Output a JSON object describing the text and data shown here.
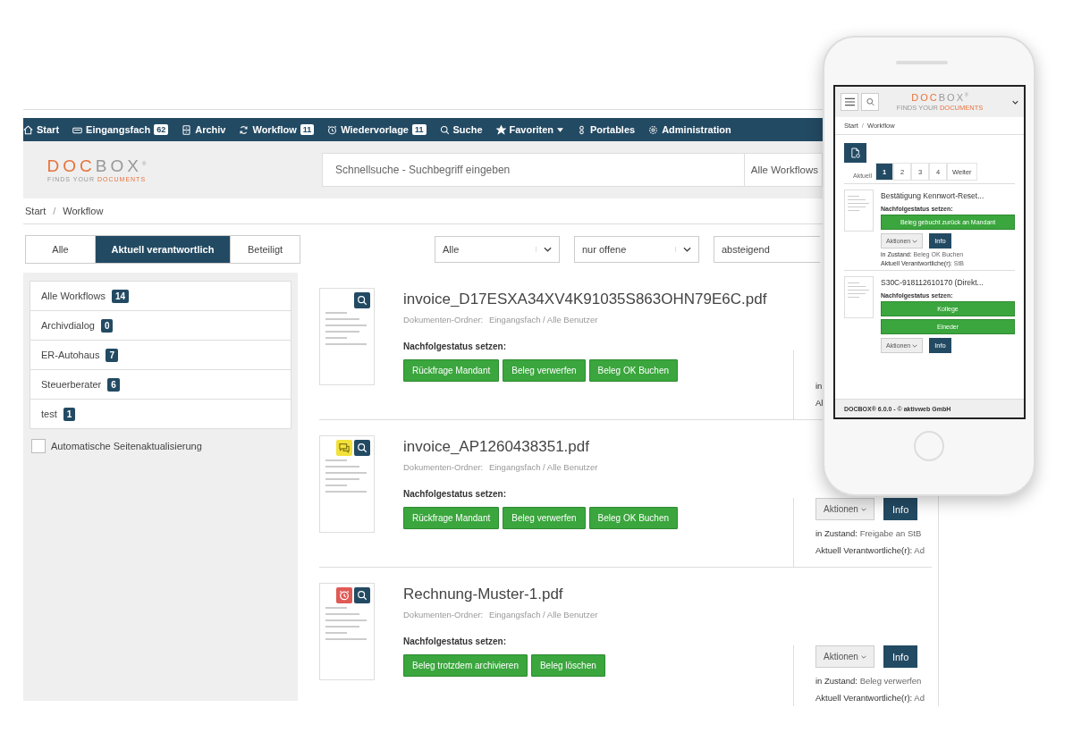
{
  "nav": [
    {
      "label": "Start",
      "dropdown": false
    },
    {
      "label": "Eingangsfach",
      "badge": "62",
      "dropdown": false
    },
    {
      "label": "Archiv",
      "dropdown": false
    },
    {
      "label": "Workflow",
      "badge": "11",
      "dropdown": false
    },
    {
      "label": "Wiedervorlage",
      "badge": "11",
      "dropdown": false
    },
    {
      "label": "Suche",
      "dropdown": false
    },
    {
      "label": "Favoriten",
      "dropdown": true
    },
    {
      "label": "Portables",
      "dropdown": false
    },
    {
      "label": "Administration",
      "dropdown": false
    }
  ],
  "logo": {
    "left": "DOC",
    "right": "BOX",
    "mark": "®",
    "tagline_left": "FINDS YOUR",
    "tagline_right": "DOCUMENTS"
  },
  "search": {
    "placeholder": "Schnellsuche - Suchbegriff eingeben",
    "scope": "Alle Workflows"
  },
  "breadcrumb": {
    "items": [
      "Start",
      "Workflow"
    ],
    "separator": "/"
  },
  "tabs": [
    {
      "label": "Alle",
      "selected": false
    },
    {
      "label": "Aktuell verantwortlich",
      "selected": true
    },
    {
      "label": "Beteiligt",
      "selected": false
    }
  ],
  "filters": [
    {
      "value": "Alle",
      "chevron": true
    },
    {
      "value": "nur offene",
      "chevron": true
    },
    {
      "value": "absteigend",
      "chevron": false
    }
  ],
  "workflows": [
    {
      "label": "Alle Workflows",
      "count": "14"
    },
    {
      "label": "Archivdialog",
      "count": "0"
    },
    {
      "label": "ER-Autohaus",
      "count": "7"
    },
    {
      "label": "Steuerberater",
      "count": "6"
    },
    {
      "label": "test",
      "count": "1"
    }
  ],
  "auto_refresh": {
    "label": "Automatische Seitenaktualisierung",
    "checked": false
  },
  "documents": [
    {
      "title": "invoice_D17ESXA34XV4K91035S863OHN79E6C.pdf",
      "folder_label": "Dokumenten-Ordner:",
      "folder": "Eingangsfach / Alle Benutzer",
      "has_comment": false,
      "has_reminder": false,
      "status_heading": "Nachfolgestatus setzen:",
      "actions": [
        "Rückfrage Mandant",
        "Beleg verwerfen",
        "Beleg OK Buchen"
      ],
      "side": {
        "state_label": "in",
        "owner_label": "Al"
      }
    },
    {
      "title": "invoice_AP1260438351.pdf",
      "folder_label": "Dokumenten-Ordner:",
      "folder": "Eingangsfach / Alle Benutzer",
      "has_comment": true,
      "has_reminder": false,
      "status_heading": "Nachfolgestatus setzen:",
      "actions": [
        "Rückfrage Mandant",
        "Beleg verwerfen",
        "Beleg OK Buchen"
      ],
      "side": {
        "menu": "Aktionen",
        "info": "Info",
        "state_label": "in Zustand:",
        "state": "Freigabe an StB",
        "owner_label": "Aktuell Verantwortliche(r):",
        "owner": "Ad"
      }
    },
    {
      "title": "Rechnung-Muster-1.pdf",
      "folder_label": "Dokumenten-Ordner:",
      "folder": "Eingangsfach / Alle Benutzer",
      "has_comment": false,
      "has_reminder": true,
      "status_heading": "Nachfolgestatus setzen:",
      "actions": [
        "Beleg trotzdem archivieren",
        "Beleg löschen"
      ],
      "side": {
        "menu": "Aktionen",
        "info": "Info",
        "state_label": "in Zustand:",
        "state": "Beleg verwerfen",
        "owner_label": "Aktuell Verantwortliche(r):",
        "owner": "Ad"
      }
    }
  ],
  "phone": {
    "logo": {
      "left": "DOC",
      "right": "BOX",
      "mark": "®",
      "tagline_left": "FINDS YOUR",
      "tagline_right": "DOCUMENTS"
    },
    "breadcrumb": {
      "items": [
        "Start",
        "Workflow"
      ],
      "separator": "/"
    },
    "pagination": {
      "label": "Aktuell",
      "pages": [
        {
          "label": "1",
          "selected": true
        },
        {
          "label": "2",
          "selected": false
        },
        {
          "label": "3",
          "selected": false
        },
        {
          "label": "4",
          "selected": false
        },
        {
          "label": "Weiter",
          "selected": false
        }
      ]
    },
    "documents": [
      {
        "title": "Bestätigung Kennwort-Reset...",
        "status_heading": "Nachfolgestatus setzen:",
        "actions": [
          "Beleg gebucht zurück an Mandant"
        ],
        "menu": "Aktionen",
        "info": "Info",
        "state_label": "in Zustand:",
        "state": "Beleg OK Buchen",
        "owner_label": "Aktuell Verantwortliche(r):",
        "owner": "StB"
      },
      {
        "title": "S30C-918112610170 (Direkt...",
        "status_heading": "Nachfolgestatus setzen:",
        "actions": [
          "Kollege",
          "Eineder"
        ],
        "menu": "Aktionen",
        "info": "Info"
      }
    ],
    "footer": "DOCBOX® 6.0.0 - © aktivweb GmbH"
  }
}
